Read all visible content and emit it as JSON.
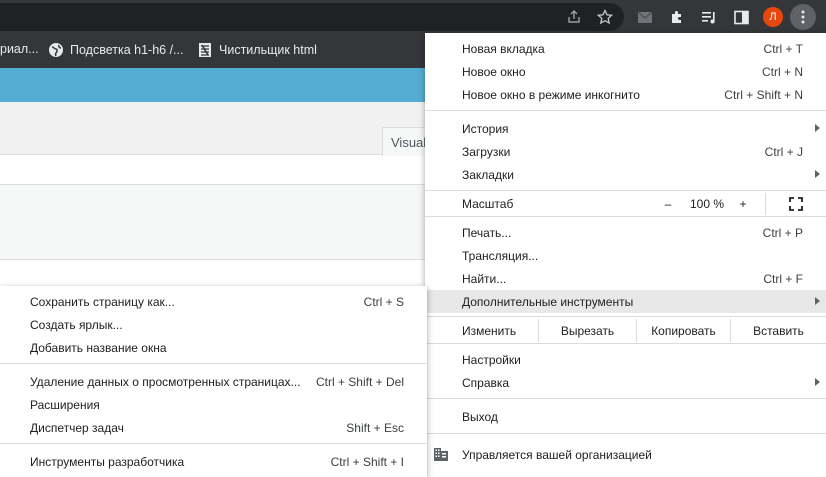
{
  "bookmarks": [
    {
      "label": "риал..."
    },
    {
      "label": "Подсветка h1-h6 /..."
    },
    {
      "label": "Чистильщик html"
    }
  ],
  "avatar_letter": "Л",
  "page": {
    "visual_tab": "Visual"
  },
  "main_menu": {
    "new_tab": {
      "label": "Новая вкладка",
      "shortcut": "Ctrl + T"
    },
    "new_window": {
      "label": "Новое окно",
      "shortcut": "Ctrl + N"
    },
    "incognito": {
      "label": "Новое окно в режиме инкогнито",
      "shortcut": "Ctrl + Shift + N"
    },
    "history": {
      "label": "История"
    },
    "downloads": {
      "label": "Загрузки",
      "shortcut": "Ctrl + J"
    },
    "bookmarks": {
      "label": "Закладки"
    },
    "zoom": {
      "label": "Масштаб",
      "minus": "–",
      "value": "100 %",
      "plus": "+"
    },
    "print": {
      "label": "Печать...",
      "shortcut": "Ctrl + P"
    },
    "cast": {
      "label": "Трансляция..."
    },
    "find": {
      "label": "Найти...",
      "shortcut": "Ctrl + F"
    },
    "more_tools": {
      "label": "Дополнительные инструменты"
    },
    "edit": {
      "label": "Изменить",
      "cut": "Вырезать",
      "copy": "Копировать",
      "paste": "Вставить"
    },
    "settings": {
      "label": "Настройки"
    },
    "help": {
      "label": "Справка"
    },
    "exit": {
      "label": "Выход"
    },
    "managed": {
      "label": "Управляется вашей организацией"
    }
  },
  "sub_menu": {
    "save_page": {
      "label": "Сохранить страницу как...",
      "shortcut": "Ctrl + S"
    },
    "create_shortcut": {
      "label": "Создать ярлык..."
    },
    "name_window": {
      "label": "Добавить название окна"
    },
    "clear_data": {
      "label": "Удаление данных о просмотренных страницах...",
      "shortcut": "Ctrl + Shift + Del"
    },
    "extensions": {
      "label": "Расширения"
    },
    "task_manager": {
      "label": "Диспетчер задач",
      "shortcut": "Shift + Esc"
    },
    "dev_tools": {
      "label": "Инструменты разработчика",
      "shortcut": "Ctrl + Shift + I"
    }
  }
}
